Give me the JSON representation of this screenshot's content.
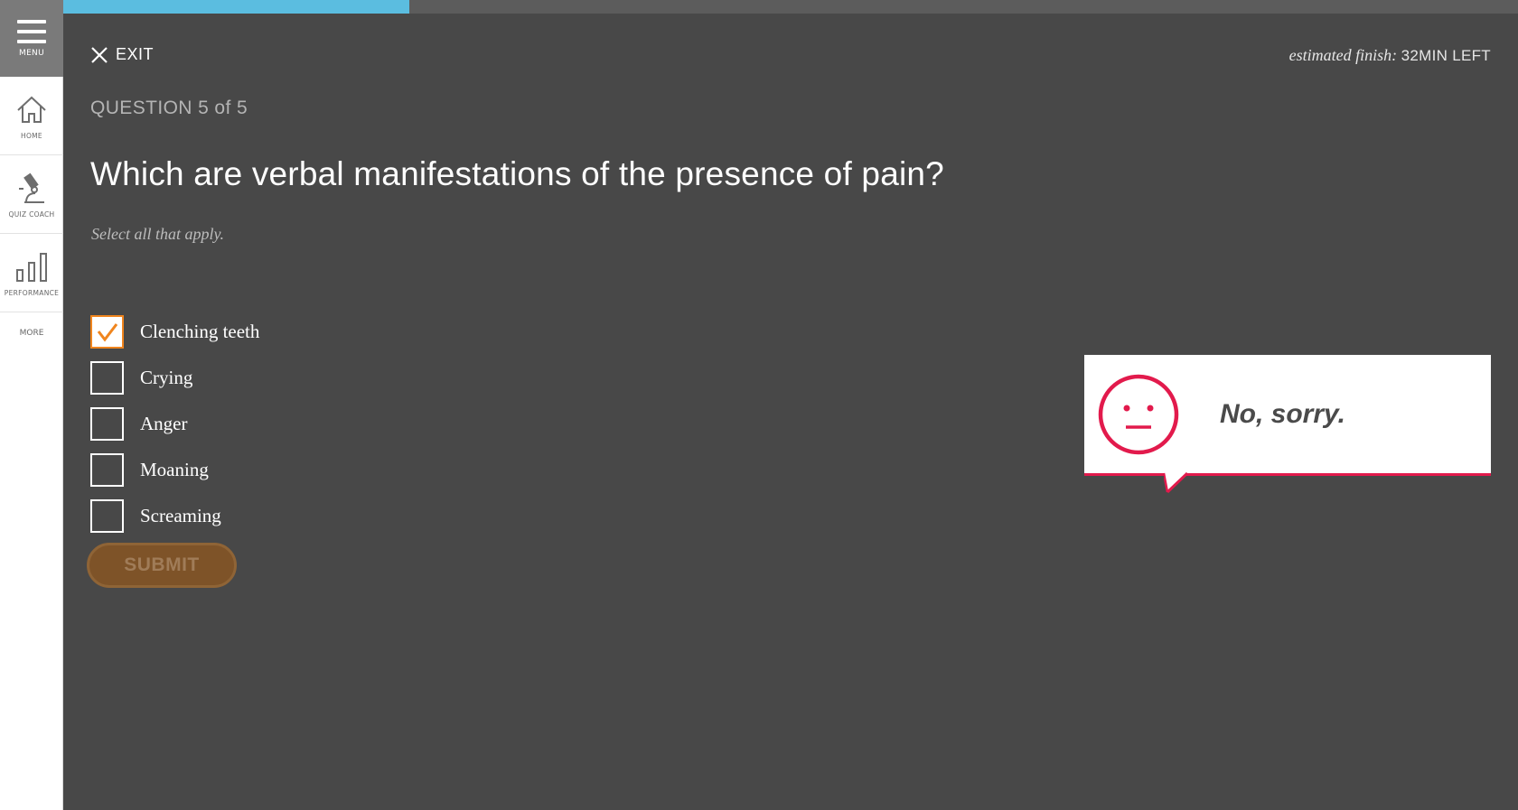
{
  "sidebar": {
    "menu_label": "MENU",
    "items": [
      {
        "label": "HOME",
        "icon": "home-icon"
      },
      {
        "label": "QUIZ COACH",
        "icon": "microscope-icon"
      },
      {
        "label": "PERFORMANCE",
        "icon": "bar-chart-icon"
      }
    ],
    "more_label": "MORE"
  },
  "progress": {
    "fraction": 0.238,
    "color": "#5bbde0"
  },
  "header": {
    "exit_label": "EXIT",
    "finish_label": "estimated finish:",
    "finish_value": "32MIN LEFT"
  },
  "question": {
    "counter": "QUESTION 5 of 5",
    "text": "Which are verbal manifestations of the presence of pain?",
    "instruction": "Select all that apply."
  },
  "options": [
    {
      "label": "Clenching teeth",
      "checked": true
    },
    {
      "label": "Crying",
      "checked": false
    },
    {
      "label": "Anger",
      "checked": false
    },
    {
      "label": "Moaning",
      "checked": false
    },
    {
      "label": "Screaming",
      "checked": false
    }
  ],
  "submit_label": "SUBMIT",
  "feedback": {
    "text": "No, sorry.",
    "icon": "neutral-face-icon",
    "accent": "#e21a4c"
  },
  "colors": {
    "background": "#484848",
    "check_accent": "#f0851e"
  }
}
